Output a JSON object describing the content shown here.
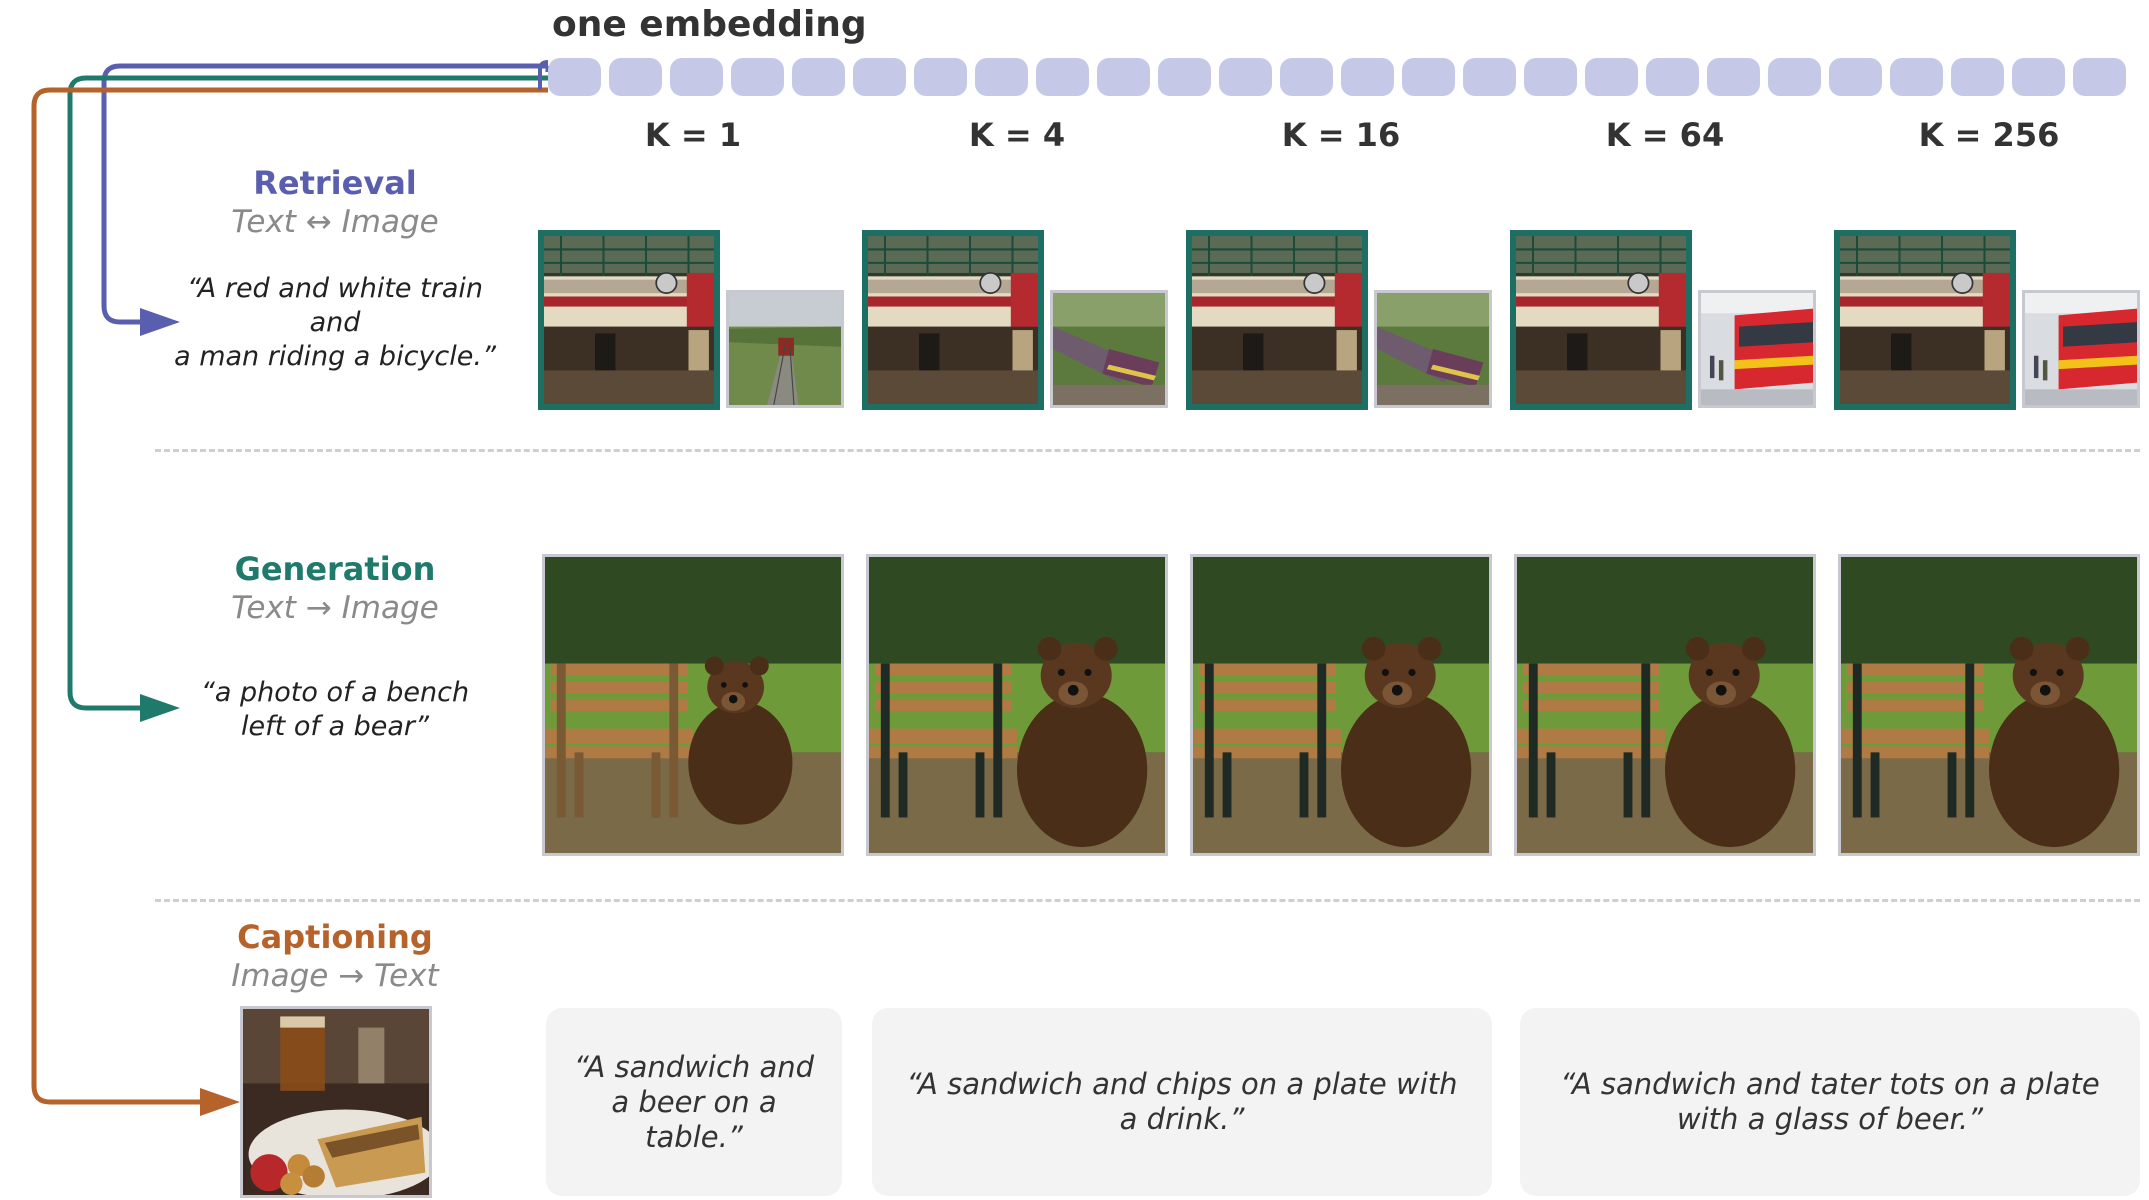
{
  "embedding_title": "one embedding",
  "k_labels": [
    "K = 1",
    "K = 4",
    "K = 16",
    "K = 64",
    "K = 256"
  ],
  "retrieval": {
    "title": "Retrieval",
    "subtitle": "Text ↔ Image",
    "prompt_lines": [
      "“A red and white train",
      "and",
      "a man riding a bicycle.”"
    ]
  },
  "generation": {
    "title": "Generation",
    "subtitle": "Text → Image",
    "prompt_lines": [
      "“a photo of a bench",
      "left of a bear”"
    ]
  },
  "captioning": {
    "title": "Captioning",
    "subtitle": "Image → Text",
    "captions": [
      "“A sandwich and a beer on a table.”",
      "“A sandwich and chips on a plate with a drink.”",
      "“A sandwich and tater tots on a plate with a glass of beer.”"
    ]
  },
  "colors": {
    "retrieval": "#5a5eae",
    "generation": "#1f7a6c",
    "captioning": "#b5622b",
    "embedding_cell": "#c6c8e8",
    "selected_border": "#1d6f63"
  },
  "icons": [
    "arrow-retrieval-icon",
    "arrow-generation-icon",
    "arrow-captioning-icon"
  ]
}
